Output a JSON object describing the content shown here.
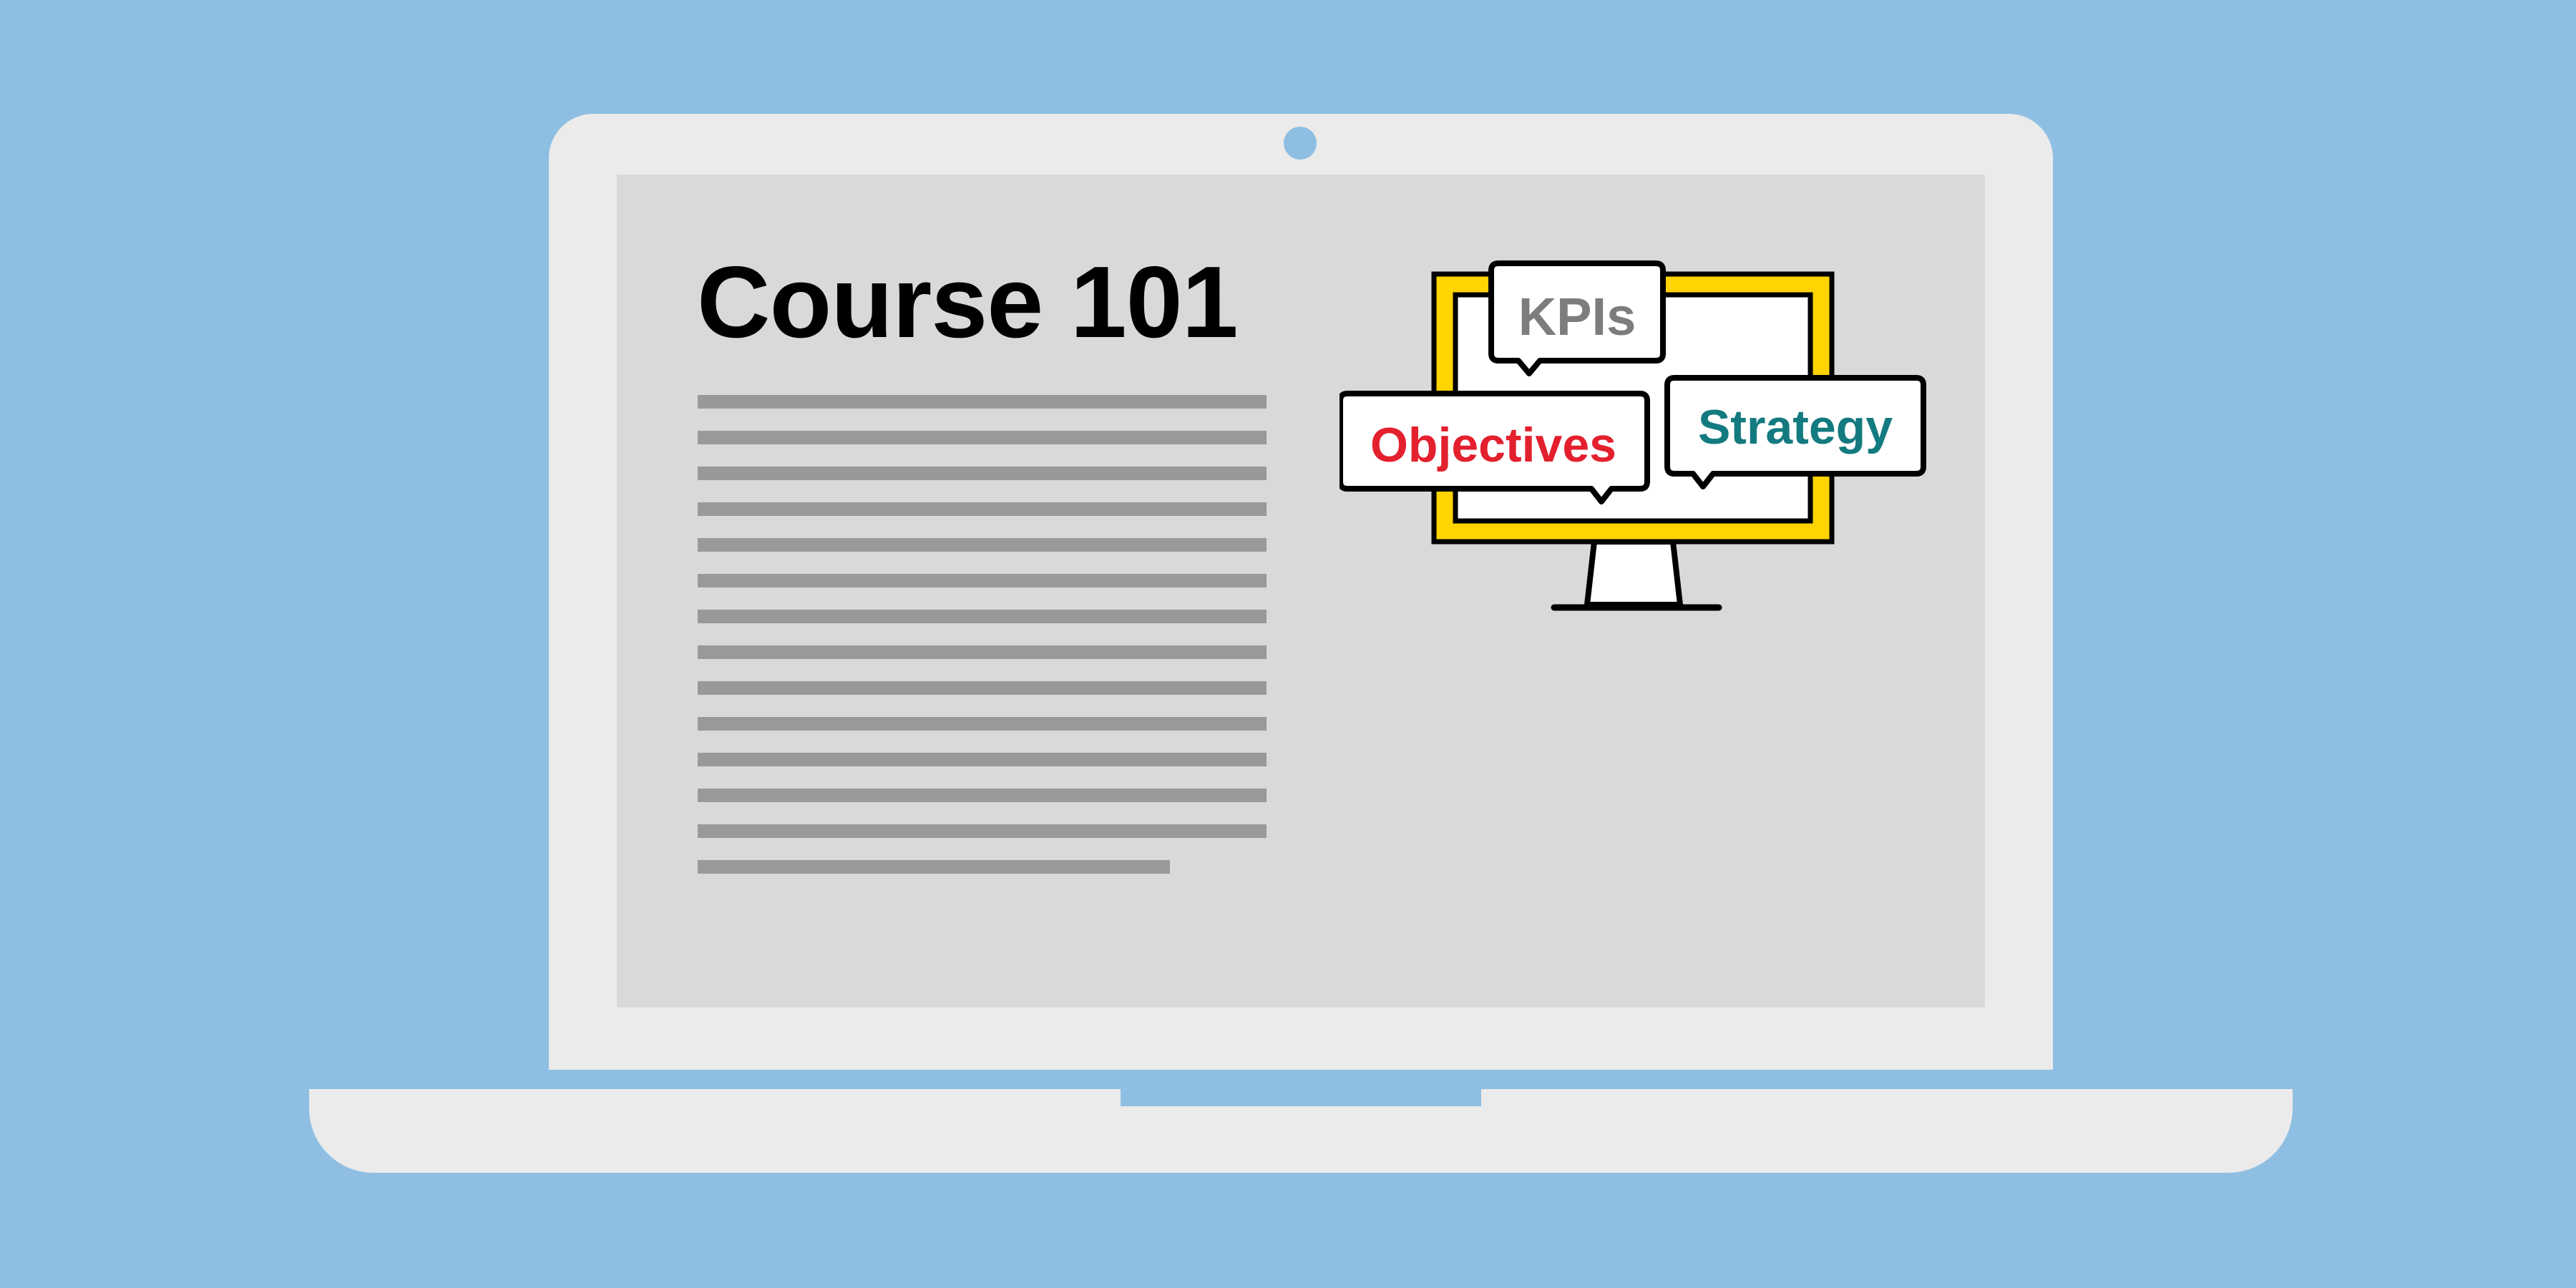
{
  "course": {
    "title": "Course 101",
    "body_line_count": 14
  },
  "illustration": {
    "bubbles": [
      {
        "label": "KPIs",
        "color": "#7d7d7d"
      },
      {
        "label": "Objectives",
        "color": "#e3202d"
      },
      {
        "label": "Strategy",
        "color": "#137a80"
      }
    ],
    "frame_color": "#ffd400"
  },
  "colors": {
    "background": "#8ebfe2",
    "laptop_body": "#ebebeb",
    "screen": "#d9d9d9",
    "text_placeholder": "#999999"
  }
}
